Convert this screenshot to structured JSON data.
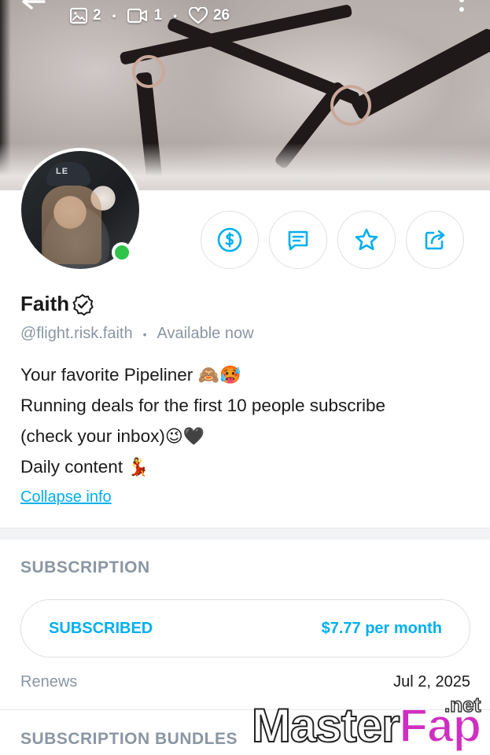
{
  "cover": {
    "stats": {
      "photos": "2",
      "videos": "1",
      "likes": "26"
    }
  },
  "profile": {
    "name": "Faith",
    "handle": "@flight.risk.faith",
    "status": "Available now",
    "avatar_cap_text": "LE",
    "online": true,
    "bio": [
      {
        "text": "Your favorite Pipeliner ",
        "emoji": "🙈🥵"
      },
      {
        "text": "Running deals for the first 10 people subscribe",
        "emoji": ""
      },
      {
        "text": "(check your inbox)",
        "emoji": "😉🖤"
      },
      {
        "text": "Daily content ",
        "emoji": "💃"
      }
    ],
    "collapse_label": "Collapse info"
  },
  "actions": [
    {
      "name": "tip",
      "icon": "dollar-circle-icon"
    },
    {
      "name": "message",
      "icon": "message-icon"
    },
    {
      "name": "favorite",
      "icon": "star-icon"
    },
    {
      "name": "share",
      "icon": "share-icon"
    }
  ],
  "subscription": {
    "title": "SUBSCRIPTION",
    "status_label": "SUBSCRIBED",
    "price_label": "$7.77 per month",
    "renews_label": "Renews",
    "renews_date": "Jul 2, 2025"
  },
  "bundles": {
    "title": "SUBSCRIPTION BUNDLES"
  },
  "watermark": {
    "master": "Master",
    "fap": "Fap",
    "net": ".net"
  },
  "colors": {
    "accent": "#00aff0",
    "muted": "#8a96a3",
    "online": "#2ec44a",
    "watermark_fap": "#cf2fc0"
  }
}
